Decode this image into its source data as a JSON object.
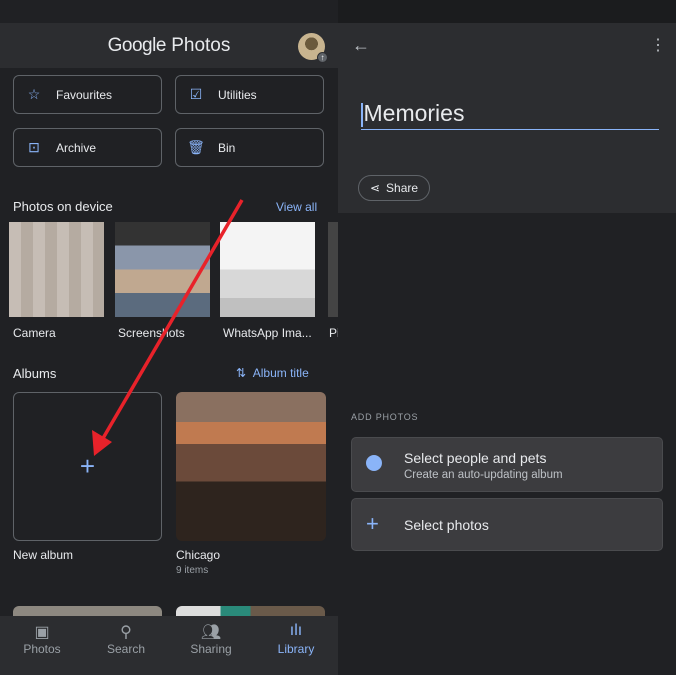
{
  "left": {
    "app_title": {
      "google": "Google",
      "photos": "Photos"
    },
    "utilities": [
      {
        "label": "Favourites",
        "icon": "star-icon"
      },
      {
        "label": "Utilities",
        "icon": "utilities-icon"
      },
      {
        "label": "Archive",
        "icon": "archive-icon"
      },
      {
        "label": "Bin",
        "icon": "bin-icon"
      }
    ],
    "device_section": {
      "title": "Photos on device",
      "view_all": "View all",
      "folders": [
        {
          "label": "Camera"
        },
        {
          "label": "Screenshots"
        },
        {
          "label": "WhatsApp Ima..."
        },
        {
          "label": "Pi"
        }
      ]
    },
    "albums_section": {
      "title": "Albums",
      "sort_label": "Album title",
      "albums": [
        {
          "label": "New album"
        },
        {
          "label": "Chicago",
          "count": "9 items"
        }
      ]
    },
    "bottom_nav": [
      {
        "label": "Photos",
        "icon": "photo-icon"
      },
      {
        "label": "Search",
        "icon": "search-icon"
      },
      {
        "label": "Sharing",
        "icon": "people-icon"
      },
      {
        "label": "Library",
        "icon": "library-icon",
        "active": true
      }
    ]
  },
  "right": {
    "album_title_value": "Memories",
    "share_label": "Share",
    "add_photos_heading": "ADD PHOTOS",
    "options": [
      {
        "title": "Select people and pets",
        "subtitle": "Create an auto-updating album",
        "icon": "face-icon"
      },
      {
        "title": "Select photos",
        "icon": "plus-icon"
      }
    ]
  },
  "colors": {
    "accent": "#8ab4f8",
    "background": "#202124",
    "annotation_arrow": "#e8222a"
  }
}
